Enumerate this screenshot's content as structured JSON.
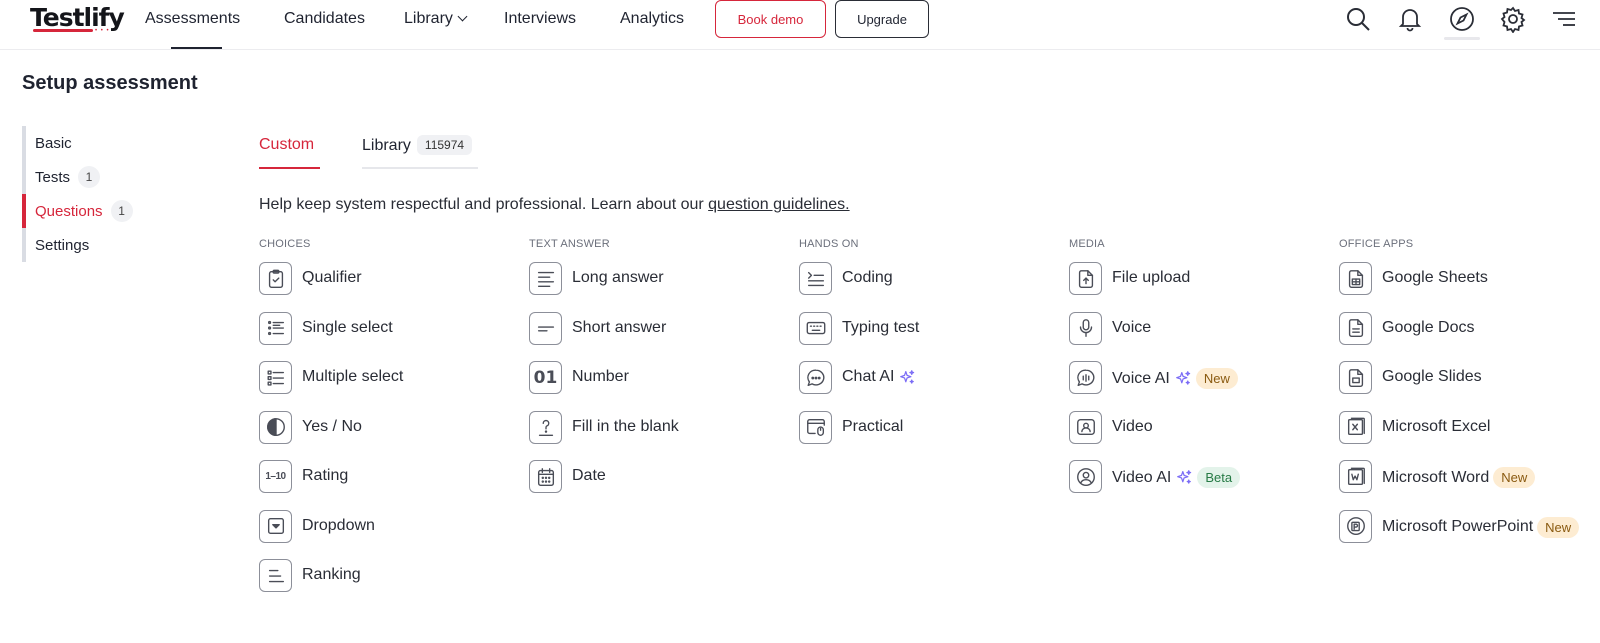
{
  "brand": {
    "name": "Testlify",
    "dots": "• • •"
  },
  "nav": {
    "assessments": "Assessments",
    "candidates": "Candidates",
    "library": "Library",
    "interviews": "Interviews",
    "analytics": "Analytics",
    "book_demo": "Book demo",
    "upgrade": "Upgrade"
  },
  "page": {
    "title": "Setup assessment"
  },
  "steps": [
    {
      "label": "Basic",
      "count": ""
    },
    {
      "label": "Tests",
      "count": "1"
    },
    {
      "label": "Questions",
      "count": "1"
    },
    {
      "label": "Settings",
      "count": ""
    }
  ],
  "tabs": {
    "custom": "Custom",
    "library": "Library",
    "library_count": "115974"
  },
  "help": {
    "text": "Help keep system respectful and professional. Learn about our ",
    "link": "question guidelines."
  },
  "columns": [
    {
      "heading": "CHOICES",
      "items": [
        {
          "label": "Qualifier",
          "icon": "clipboard-check-icon"
        },
        {
          "label": "Single select",
          "icon": "list-icon"
        },
        {
          "label": "Multiple select",
          "icon": "list-checks-icon"
        },
        {
          "label": "Yes / No",
          "icon": "half-circle-icon"
        },
        {
          "label": "Rating",
          "icon": "rating-scale-icon",
          "icon_text": "1–10"
        },
        {
          "label": "Dropdown",
          "icon": "dropdown-icon"
        },
        {
          "label": "Ranking",
          "icon": "ranking-icon"
        }
      ]
    },
    {
      "heading": "TEXT ANSWER",
      "items": [
        {
          "label": "Long answer",
          "icon": "paragraph-icon"
        },
        {
          "label": "Short answer",
          "icon": "short-line-icon"
        },
        {
          "label": "Number",
          "icon": "number-icon",
          "icon_text": "01"
        },
        {
          "label": "Fill in the blank",
          "icon": "question-mark-icon"
        },
        {
          "label": "Date",
          "icon": "calendar-icon"
        }
      ]
    },
    {
      "heading": "HANDS ON",
      "items": [
        {
          "label": "Coding",
          "icon": "code-lines-icon"
        },
        {
          "label": "Typing test",
          "icon": "keyboard-icon"
        },
        {
          "label": "Chat AI",
          "icon": "chat-icon",
          "ai": true
        },
        {
          "label": "Practical",
          "icon": "window-mouse-icon"
        }
      ]
    },
    {
      "heading": "MEDIA",
      "items": [
        {
          "label": "File upload",
          "icon": "file-upload-icon"
        },
        {
          "label": "Voice",
          "icon": "microphone-icon"
        },
        {
          "label": "Voice AI",
          "icon": "voice-bubble-icon",
          "ai": true,
          "badge": "New",
          "badge_type": "new"
        },
        {
          "label": "Video",
          "icon": "video-user-icon"
        },
        {
          "label": "Video AI",
          "icon": "user-circle-icon",
          "ai": true,
          "badge": "Beta",
          "badge_type": "beta"
        }
      ]
    },
    {
      "heading": "OFFICE APPS",
      "items": [
        {
          "label": "Google Sheets",
          "icon": "sheet-file-icon"
        },
        {
          "label": "Google Docs",
          "icon": "doc-file-icon"
        },
        {
          "label": "Google Slides",
          "icon": "slides-file-icon"
        },
        {
          "label": "Microsoft Excel",
          "icon": "excel-file-icon"
        },
        {
          "label": "Microsoft Word",
          "icon": "word-file-icon",
          "badge": "New",
          "badge_type": "new"
        },
        {
          "label": "Microsoft PowerPoint",
          "icon": "powerpoint-file-icon",
          "badge": "New",
          "badge_type": "new"
        }
      ]
    }
  ],
  "colors": {
    "accent": "#d6263b",
    "text": "#1f2330",
    "ai_sparkle": "#7b6cf6"
  }
}
